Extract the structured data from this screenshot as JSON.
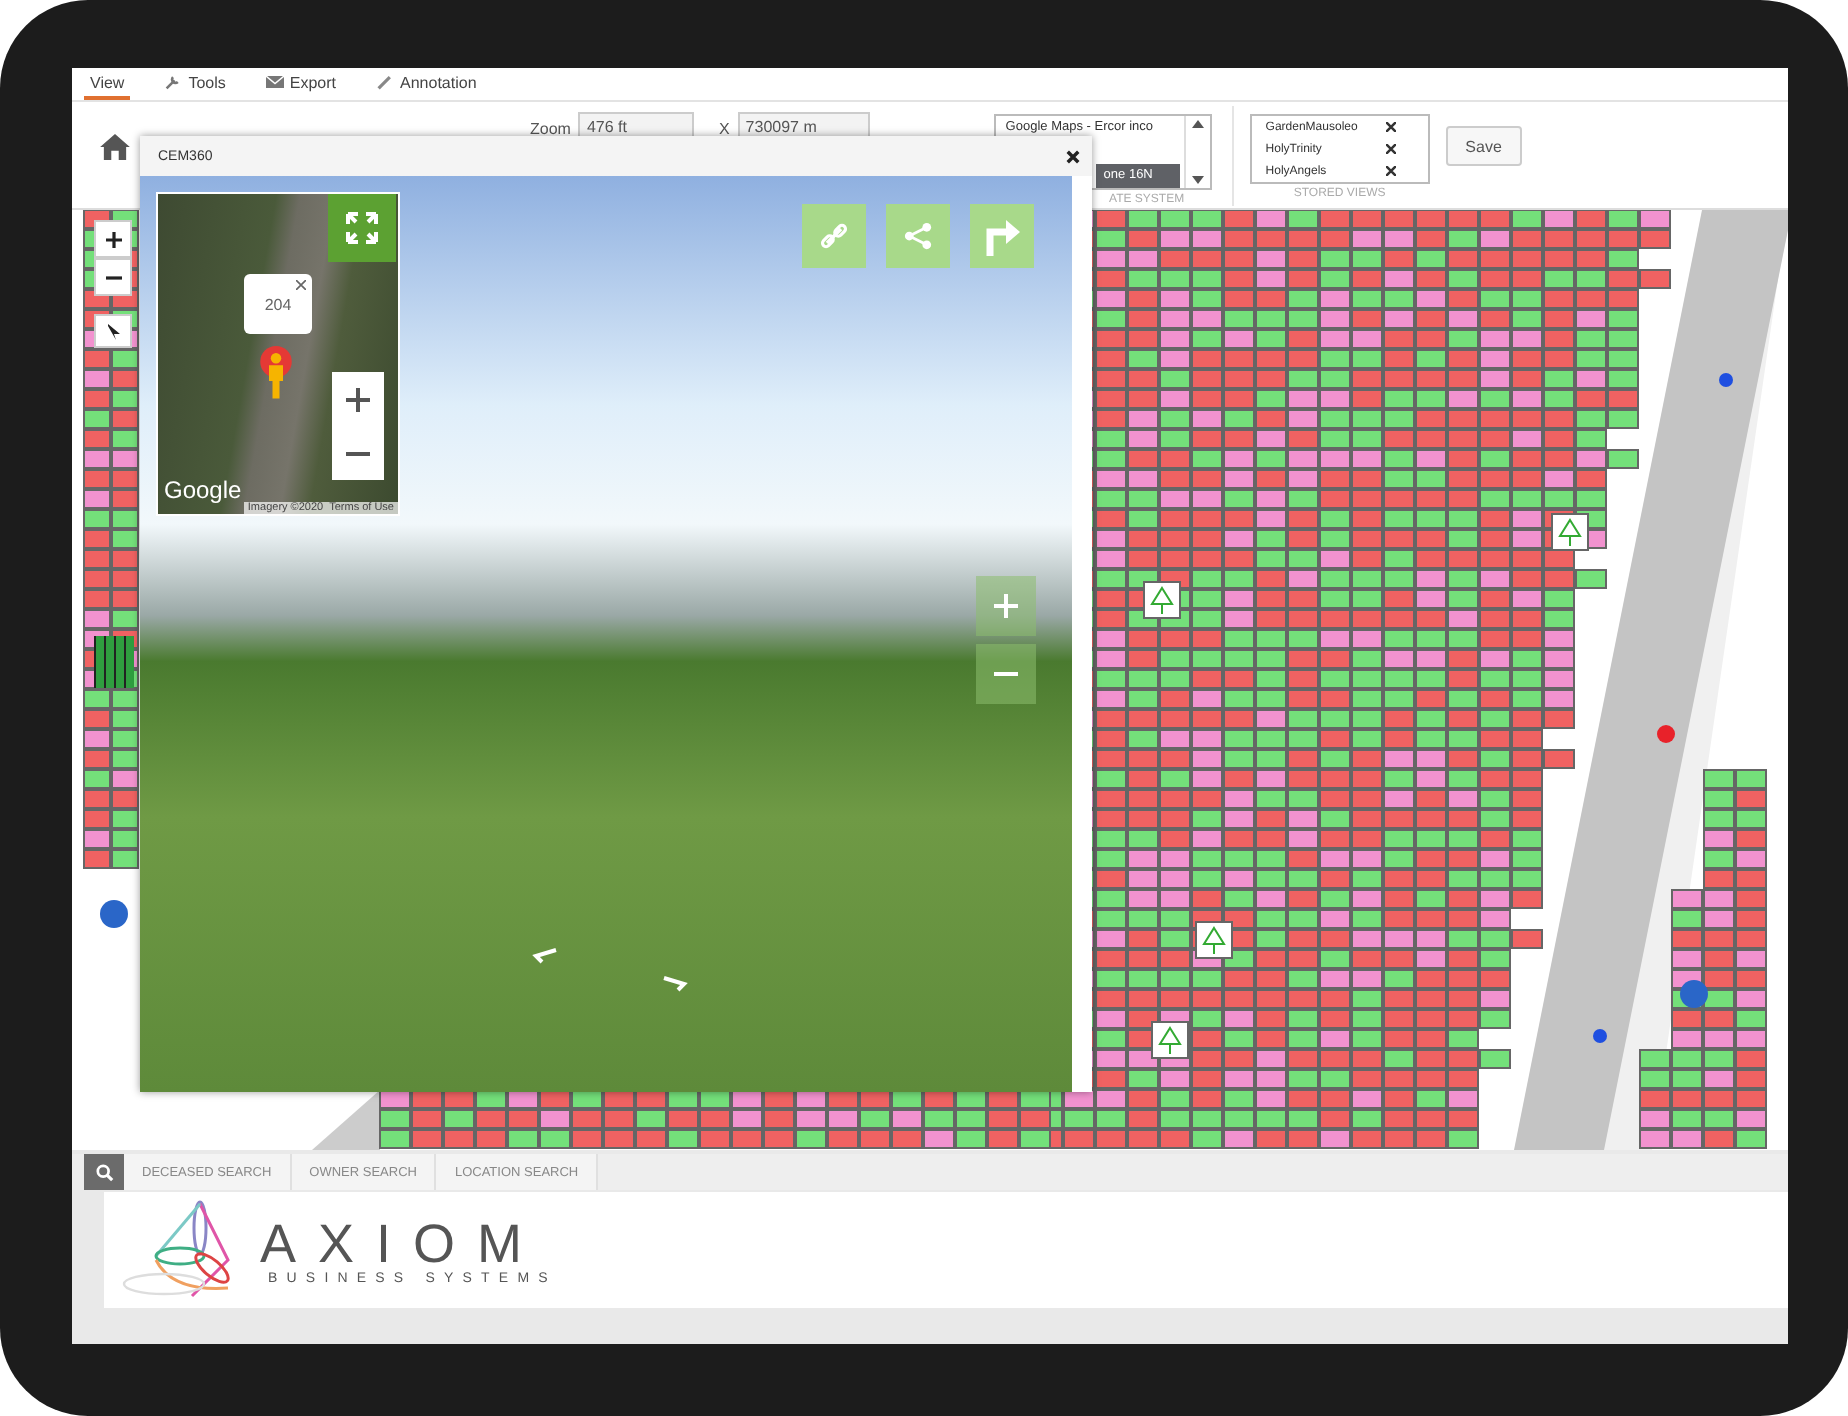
{
  "menu_tabs": [
    {
      "label": "View",
      "selected": true
    },
    {
      "label": "Tools",
      "selected": false
    },
    {
      "label": "Export",
      "selected": false
    },
    {
      "label": "Annotation",
      "selected": false
    }
  ],
  "toolbar": {
    "zoom_label": "Zoom",
    "zoom_value": "476 ft",
    "x_label": "X",
    "x_value": "730097 m"
  },
  "coordinate_system": {
    "items": [
      {
        "label": "Google Maps - Ercor inco",
        "selected": false
      },
      {
        "label": "one 16N",
        "selected": true
      }
    ],
    "caption": "ATE SYSTEM"
  },
  "stored_views": {
    "items": [
      {
        "label": "GardenMausoleo"
      },
      {
        "label": "HolyTrinity"
      },
      {
        "label": "HolyAngels"
      }
    ],
    "caption": "STORED VIEWS",
    "save_button": "Save"
  },
  "popup": {
    "title": "CEM360",
    "marker_label": "204",
    "map_logo": "Google",
    "attribution": [
      "Imagery ©2020",
      "Terms of Use"
    ]
  },
  "search_tabs": [
    "DECEASED SEARCH",
    "OWNER SEARCH",
    "LOCATION SEARCH"
  ],
  "logo": {
    "name": "AXIOM",
    "tagline": "BUSINESS SYSTEMS"
  }
}
